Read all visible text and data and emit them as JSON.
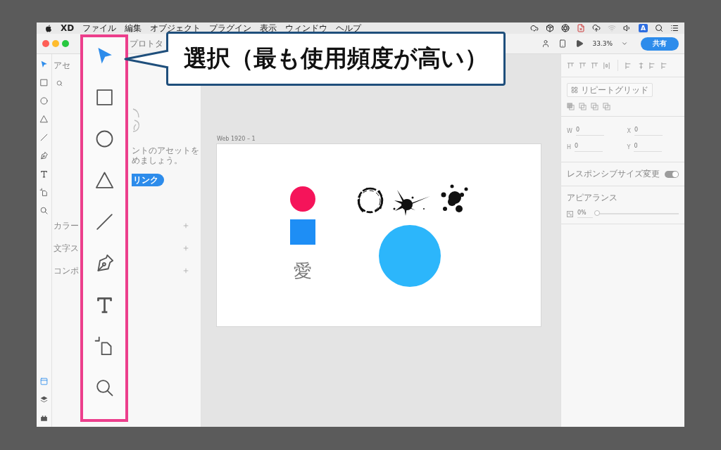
{
  "menu_bar": {
    "app": "XD",
    "menus": [
      "ファイル",
      "編集",
      "オブジェクト",
      "プラグイン",
      "表示",
      "ウィンドウ",
      "ヘルプ"
    ],
    "input_source": "A"
  },
  "title_bar": {
    "tab": "プロトタ",
    "zoom": "33.3%",
    "share": "共有"
  },
  "tools": [
    {
      "kind": "select",
      "selected": true
    },
    {
      "kind": "rectangle",
      "selected": false
    },
    {
      "kind": "ellipse",
      "selected": false
    },
    {
      "kind": "polygon",
      "selected": false
    },
    {
      "kind": "line",
      "selected": false
    },
    {
      "kind": "pen",
      "selected": false
    },
    {
      "kind": "text",
      "selected": false
    },
    {
      "kind": "artboard",
      "selected": false
    },
    {
      "kind": "zoom",
      "selected": false
    }
  ],
  "bottom_tools": [
    {
      "kind": "artboards",
      "selected": true
    },
    {
      "kind": "layers",
      "selected": false
    },
    {
      "kind": "plugins",
      "selected": false
    }
  ],
  "assets_panel": {
    "title": "アセ",
    "message": [
      "ントのアセットを",
      "めましょう。"
    ],
    "link_button": "リンク",
    "sections": [
      "カラー",
      "文字ス",
      "コンポ"
    ]
  },
  "artboard": {
    "title": "Web 1920 – 1",
    "shapes": [
      {
        "kind": "circle",
        "color": "#f5145a"
      },
      {
        "kind": "square",
        "color": "#1e8ef5"
      },
      {
        "kind": "text",
        "text": "愛"
      },
      {
        "kind": "ring"
      },
      {
        "kind": "splatter"
      },
      {
        "kind": "blot"
      },
      {
        "kind": "circle",
        "color": "#2cb6fb"
      }
    ]
  },
  "inspector": {
    "repeat_grid": "リピートグリッド",
    "fields": [
      {
        "label": "W",
        "value": "0"
      },
      {
        "label": "X",
        "value": "0"
      },
      {
        "label": "H",
        "value": "0"
      },
      {
        "label": "Y",
        "value": "0"
      }
    ],
    "responsive": {
      "label": "レスポンシブサイズ変更",
      "on": true
    },
    "appearance": {
      "title": "アピアランス",
      "opacity": "0%",
      "level": 0
    }
  },
  "callout": {
    "text": "選択（最も使用頻度が高い）"
  }
}
